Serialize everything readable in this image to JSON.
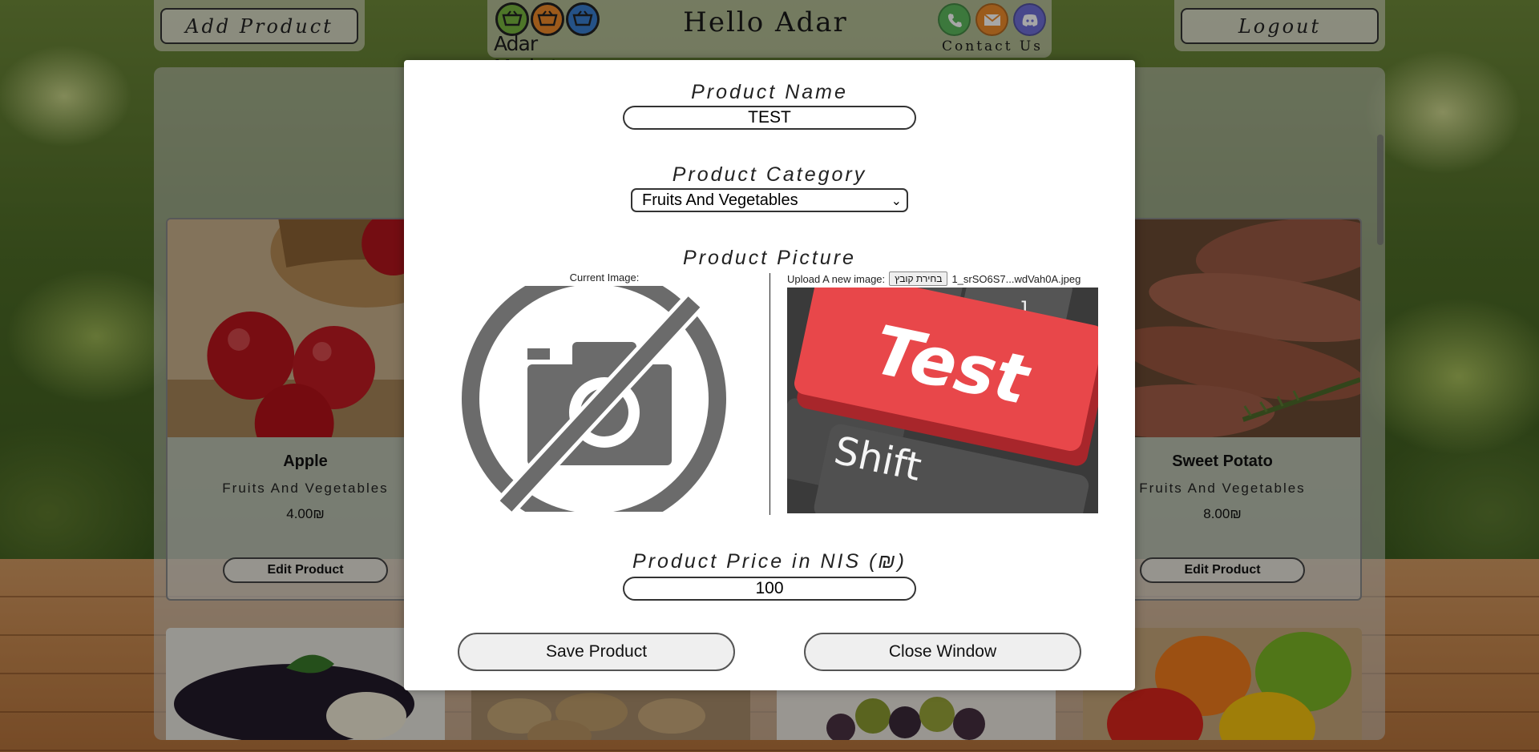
{
  "header": {
    "add_product_label": "Add Product",
    "logout_label": "Logout",
    "logo_text": "Adar Market",
    "greeting": "Hello Adar",
    "contact_label": "Contact Us"
  },
  "products": [
    {
      "name": "Apple",
      "category": "Fruits And Vegetables",
      "price": "4.00₪",
      "edit_label": "Edit Product"
    },
    {
      "name": "Sweet Potato",
      "category": "Fruits And Vegetables",
      "price": "8.00₪",
      "edit_label": "Edit Product"
    }
  ],
  "modal": {
    "name_label": "Product Name",
    "name_value": "TEST",
    "category_label": "Product Category",
    "category_selected": "Fruits And Vegetables",
    "picture_label": "Product Picture",
    "current_image_label": "Current Image:",
    "upload_label": "Upload A new image:",
    "upload_button": "בחירת קובץ",
    "upload_filename": "1_srSO6S7...wdVah0A.jpeg",
    "new_image_text_top": "Test",
    "new_image_text_bottom": "Shift",
    "new_image_key_char": "]",
    "price_label": "Product Price in NIS (₪)",
    "price_value": "100",
    "save_label": "Save Product",
    "close_label": "Close Window"
  },
  "colors": {
    "test_key": "#e8474a",
    "keyboard": "#3a3a3a",
    "no_camera_gray": "#6b6b6b"
  }
}
